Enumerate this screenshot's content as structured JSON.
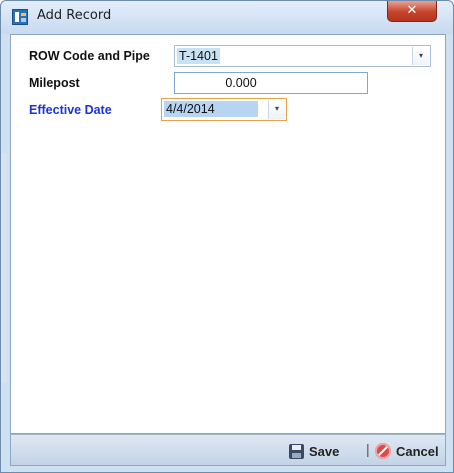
{
  "window": {
    "title": "Add Record",
    "close_label": "✕"
  },
  "form": {
    "row_code_label": "ROW Code and Pipe",
    "row_code_value": "T-1401",
    "milepost_label": "Milepost",
    "milepost_value": "0.000",
    "effective_date_label": "Effective Date",
    "effective_date_value": "4/4/2014",
    "dropdown_glyph": "▾"
  },
  "footer": {
    "save_label": "Save",
    "separator": "|",
    "cancel_label": "Cancel"
  },
  "colors": {
    "label_blue": "#1b34d8",
    "title_bar": "#c7daf0",
    "close_red": "#c7432b"
  },
  "icons": {
    "app": "app-icon",
    "close": "close-icon",
    "save": "floppy-disk-icon",
    "cancel": "cancel-circle-icon",
    "dropdown": "chevron-down-icon"
  }
}
